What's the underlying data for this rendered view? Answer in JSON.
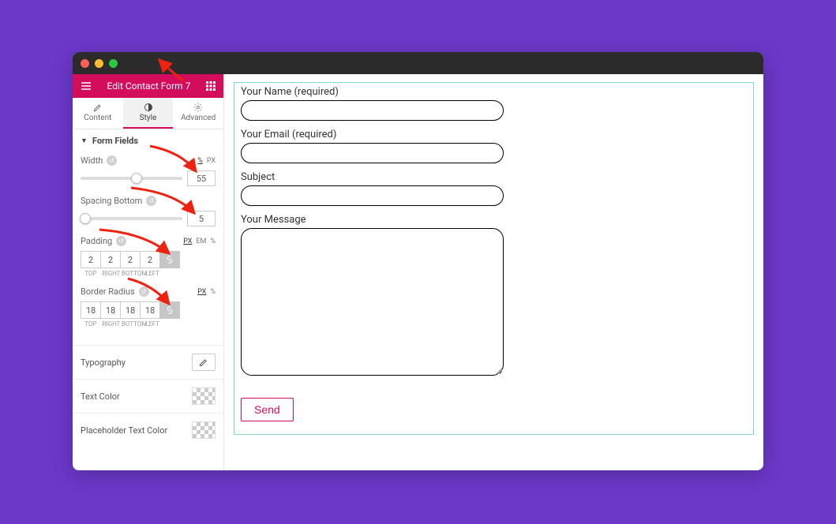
{
  "header": {
    "title": "Edit Contact Form 7"
  },
  "tabs": {
    "content": "Content",
    "style": "Style",
    "advanced": "Advanced"
  },
  "section": {
    "form_fields": "Form Fields"
  },
  "width": {
    "label": "Width",
    "unit_pct": "%",
    "unit_px": "PX",
    "value": "55"
  },
  "spacing": {
    "label": "Spacing Bottom",
    "value": "5"
  },
  "padding": {
    "label": "Padding",
    "unit_px": "PX",
    "unit_em": "EM",
    "unit_pct": "%",
    "top": "2",
    "right": "2",
    "bottom": "2",
    "left": "2",
    "lbl_top": "TOP",
    "lbl_right": "RIGHT",
    "lbl_bottom": "BOTTOM",
    "lbl_left": "LEFT"
  },
  "radius": {
    "label": "Border Radius",
    "unit_px": "PX",
    "unit_pct": "%",
    "top": "18",
    "right": "18",
    "bottom": "18",
    "left": "18",
    "lbl_top": "TOP",
    "lbl_right": "RIGHT",
    "lbl_bottom": "BOTTOM",
    "lbl_left": "LEFT"
  },
  "rows": {
    "typography": "Typography",
    "text_color": "Text Color",
    "placeholder_color": "Placeholder Text Color"
  },
  "form": {
    "name": "Your Name (required)",
    "email": "Your Email (required)",
    "subject": "Subject",
    "message": "Your Message",
    "send": "Send"
  }
}
